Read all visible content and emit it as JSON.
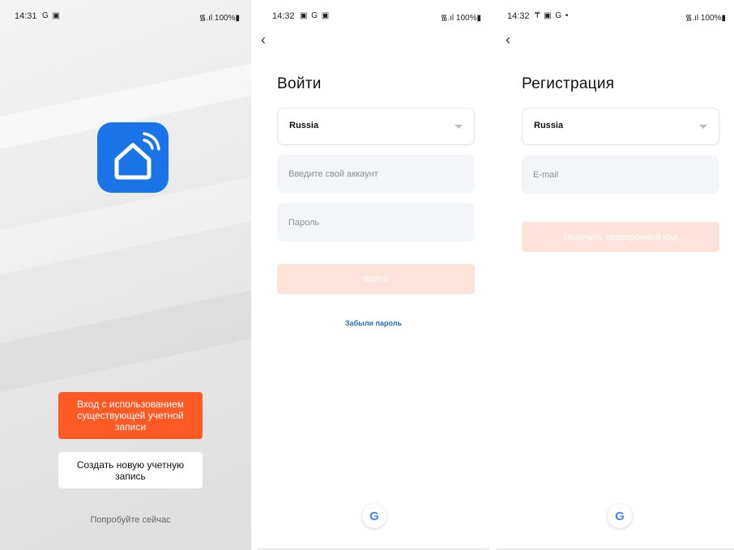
{
  "screen1": {
    "status": {
      "time": "14:31",
      "icons": "G ▣",
      "right": "᯾.ıl 100%▮"
    },
    "buttons": {
      "login_existing": "Вход с использованием существующей учетной записи",
      "create_account": "Создать новую учетную запись",
      "try_now": "Попробуйте сейчас"
    },
    "icons": {
      "app_logo": "smart-home-icon"
    }
  },
  "screen2": {
    "status": {
      "time": "14:32",
      "icons": "▣ G ▣",
      "right": "᯾.ıl 100%▮"
    },
    "title": "Войти",
    "country": "Russia",
    "account_placeholder": "Введите свой аккаунт",
    "password_placeholder": "Пароль",
    "submit_label": "Войти",
    "forgot_password": "Забыли пароль",
    "google_label": "G"
  },
  "screen3": {
    "status": {
      "time": "14:32",
      "icons": "₸ ▣ G •",
      "right": "᯾.ıl 100%▮"
    },
    "title": "Регистрация",
    "country": "Russia",
    "email_placeholder": "E-mail",
    "submit_label": "Получить проверочный код",
    "google_label": "G"
  },
  "colors": {
    "accent": "#ff5a26",
    "accent_disabled": "#fde0d6",
    "app_icon": "#1a74e8",
    "link": "#1f6fb8"
  }
}
